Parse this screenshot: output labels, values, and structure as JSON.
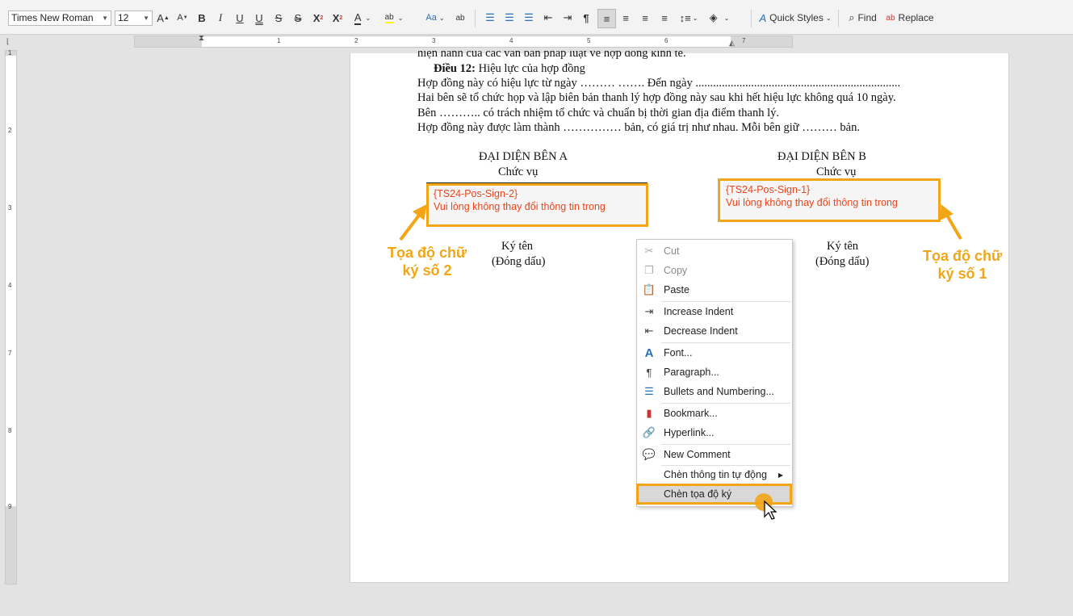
{
  "toolbar": {
    "font_name": "Times New Roman",
    "font_size": "12",
    "quick_styles": "Quick Styles",
    "find": "Find",
    "replace": "Replace"
  },
  "ruler": {
    "h_labels": [
      "1",
      "2",
      "3",
      "4",
      "5",
      "6",
      "7"
    ],
    "v_labels": [
      "1",
      "2",
      "3",
      "4",
      "5",
      "6",
      "7",
      "8",
      "9"
    ]
  },
  "document": {
    "line0": "hiện hành của các văn bản pháp luật về hợp đồng kinh tế.",
    "article_bold": "Điều 12:",
    "article_title": " Hiệu lực của hợp đồng",
    "line2": "Hợp đồng này có hiệu lực từ ngày ……… ……. Đến ngày ......................................................................",
    "line3": "Hai bên sẽ tổ chức họp và lập biên bản thanh lý hợp đồng này sau khi hết hiệu lực không quá 10 ngày.",
    "line4": "Bên ……….. có trách nhiệm tổ chức và chuẩn bị thời gian địa điểm thanh lý.",
    "line5": "Hợp đồng này được làm thành …………… bản, có giá trị như nhau. Mỗi bên giữ ……… bản.",
    "party_a": {
      "title": "ĐẠI DIỆN BÊN A",
      "position": "Chức vụ",
      "sig_tag": "{TS24-Pos-Sign-2}",
      "sig_note": "Vui lòng không thay đổi thông tin trong",
      "sign": "Ký tên",
      "stamp": "(Đóng dấu)"
    },
    "party_b": {
      "title": "ĐẠI DIỆN BÊN B",
      "position": "Chức vụ",
      "sig_tag": "{TS24-Pos-Sign-1}",
      "sig_note": "Vui lòng không thay đổi thông tin trong",
      "sign": "Ký tên",
      "stamp": "(Đóng dấu)"
    }
  },
  "annotations": {
    "left_line1": "Tọa độ chữ",
    "left_line2": "ký số 2",
    "right_line1": "Tọa độ chữ",
    "right_line2": "ký số 1",
    "accent": "#f2a516"
  },
  "context_menu": {
    "items": [
      {
        "label": "Cut",
        "icon": "scissors-icon",
        "enabled": false
      },
      {
        "label": "Copy",
        "icon": "copy-icon",
        "enabled": false
      },
      {
        "label": "Paste",
        "icon": "paste-icon",
        "enabled": true
      },
      {
        "label": "Increase Indent",
        "icon": "increase-indent-icon",
        "enabled": true
      },
      {
        "label": "Decrease Indent",
        "icon": "decrease-indent-icon",
        "enabled": true
      },
      {
        "label": "Font...",
        "icon": "font-icon",
        "enabled": true
      },
      {
        "label": "Paragraph...",
        "icon": "paragraph-icon",
        "enabled": true
      },
      {
        "label": "Bullets and Numbering...",
        "icon": "bullets-icon",
        "enabled": true
      },
      {
        "label": "Bookmark...",
        "icon": "bookmark-icon",
        "enabled": true
      },
      {
        "label": "Hyperlink...",
        "icon": "link-icon",
        "enabled": true
      },
      {
        "label": "New Comment",
        "icon": "comment-icon",
        "enabled": true
      },
      {
        "label": "Chèn thông tin tự động",
        "icon": "",
        "enabled": true
      },
      {
        "label": "Chèn tọa độ ký",
        "icon": "",
        "enabled": true
      }
    ]
  }
}
